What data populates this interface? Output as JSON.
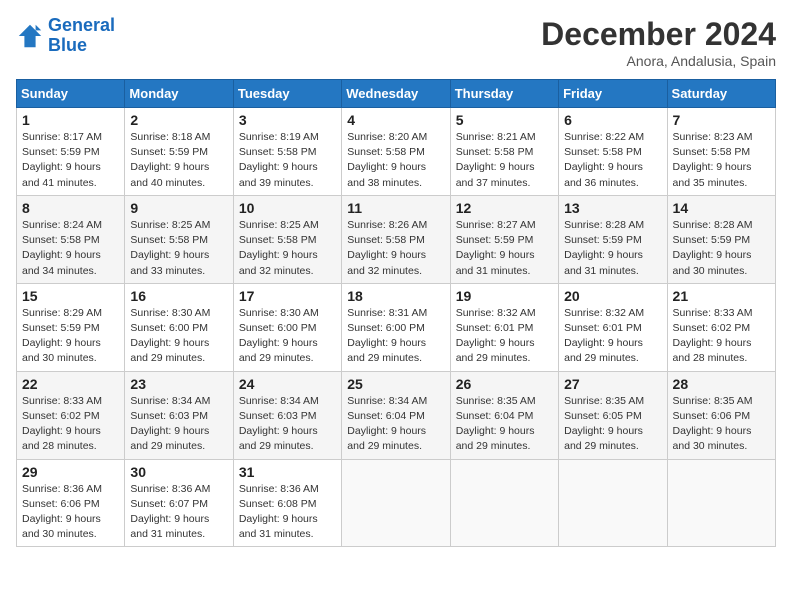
{
  "logo": {
    "line1": "General",
    "line2": "Blue"
  },
  "title": "December 2024",
  "location": "Anora, Andalusia, Spain",
  "weekdays": [
    "Sunday",
    "Monday",
    "Tuesday",
    "Wednesday",
    "Thursday",
    "Friday",
    "Saturday"
  ],
  "weeks": [
    [
      {
        "day": "1",
        "sunrise": "8:17 AM",
        "sunset": "5:59 PM",
        "daylight": "9 hours and 41 minutes."
      },
      {
        "day": "2",
        "sunrise": "8:18 AM",
        "sunset": "5:59 PM",
        "daylight": "9 hours and 40 minutes."
      },
      {
        "day": "3",
        "sunrise": "8:19 AM",
        "sunset": "5:58 PM",
        "daylight": "9 hours and 39 minutes."
      },
      {
        "day": "4",
        "sunrise": "8:20 AM",
        "sunset": "5:58 PM",
        "daylight": "9 hours and 38 minutes."
      },
      {
        "day": "5",
        "sunrise": "8:21 AM",
        "sunset": "5:58 PM",
        "daylight": "9 hours and 37 minutes."
      },
      {
        "day": "6",
        "sunrise": "8:22 AM",
        "sunset": "5:58 PM",
        "daylight": "9 hours and 36 minutes."
      },
      {
        "day": "7",
        "sunrise": "8:23 AM",
        "sunset": "5:58 PM",
        "daylight": "9 hours and 35 minutes."
      }
    ],
    [
      {
        "day": "8",
        "sunrise": "8:24 AM",
        "sunset": "5:58 PM",
        "daylight": "9 hours and 34 minutes."
      },
      {
        "day": "9",
        "sunrise": "8:25 AM",
        "sunset": "5:58 PM",
        "daylight": "9 hours and 33 minutes."
      },
      {
        "day": "10",
        "sunrise": "8:25 AM",
        "sunset": "5:58 PM",
        "daylight": "9 hours and 32 minutes."
      },
      {
        "day": "11",
        "sunrise": "8:26 AM",
        "sunset": "5:58 PM",
        "daylight": "9 hours and 32 minutes."
      },
      {
        "day": "12",
        "sunrise": "8:27 AM",
        "sunset": "5:59 PM",
        "daylight": "9 hours and 31 minutes."
      },
      {
        "day": "13",
        "sunrise": "8:28 AM",
        "sunset": "5:59 PM",
        "daylight": "9 hours and 31 minutes."
      },
      {
        "day": "14",
        "sunrise": "8:28 AM",
        "sunset": "5:59 PM",
        "daylight": "9 hours and 30 minutes."
      }
    ],
    [
      {
        "day": "15",
        "sunrise": "8:29 AM",
        "sunset": "5:59 PM",
        "daylight": "9 hours and 30 minutes."
      },
      {
        "day": "16",
        "sunrise": "8:30 AM",
        "sunset": "6:00 PM",
        "daylight": "9 hours and 29 minutes."
      },
      {
        "day": "17",
        "sunrise": "8:30 AM",
        "sunset": "6:00 PM",
        "daylight": "9 hours and 29 minutes."
      },
      {
        "day": "18",
        "sunrise": "8:31 AM",
        "sunset": "6:00 PM",
        "daylight": "9 hours and 29 minutes."
      },
      {
        "day": "19",
        "sunrise": "8:32 AM",
        "sunset": "6:01 PM",
        "daylight": "9 hours and 29 minutes."
      },
      {
        "day": "20",
        "sunrise": "8:32 AM",
        "sunset": "6:01 PM",
        "daylight": "9 hours and 29 minutes."
      },
      {
        "day": "21",
        "sunrise": "8:33 AM",
        "sunset": "6:02 PM",
        "daylight": "9 hours and 28 minutes."
      }
    ],
    [
      {
        "day": "22",
        "sunrise": "8:33 AM",
        "sunset": "6:02 PM",
        "daylight": "9 hours and 28 minutes."
      },
      {
        "day": "23",
        "sunrise": "8:34 AM",
        "sunset": "6:03 PM",
        "daylight": "9 hours and 29 minutes."
      },
      {
        "day": "24",
        "sunrise": "8:34 AM",
        "sunset": "6:03 PM",
        "daylight": "9 hours and 29 minutes."
      },
      {
        "day": "25",
        "sunrise": "8:34 AM",
        "sunset": "6:04 PM",
        "daylight": "9 hours and 29 minutes."
      },
      {
        "day": "26",
        "sunrise": "8:35 AM",
        "sunset": "6:04 PM",
        "daylight": "9 hours and 29 minutes."
      },
      {
        "day": "27",
        "sunrise": "8:35 AM",
        "sunset": "6:05 PM",
        "daylight": "9 hours and 29 minutes."
      },
      {
        "day": "28",
        "sunrise": "8:35 AM",
        "sunset": "6:06 PM",
        "daylight": "9 hours and 30 minutes."
      }
    ],
    [
      {
        "day": "29",
        "sunrise": "8:36 AM",
        "sunset": "6:06 PM",
        "daylight": "9 hours and 30 minutes."
      },
      {
        "day": "30",
        "sunrise": "8:36 AM",
        "sunset": "6:07 PM",
        "daylight": "9 hours and 31 minutes."
      },
      {
        "day": "31",
        "sunrise": "8:36 AM",
        "sunset": "6:08 PM",
        "daylight": "9 hours and 31 minutes."
      },
      null,
      null,
      null,
      null
    ]
  ]
}
